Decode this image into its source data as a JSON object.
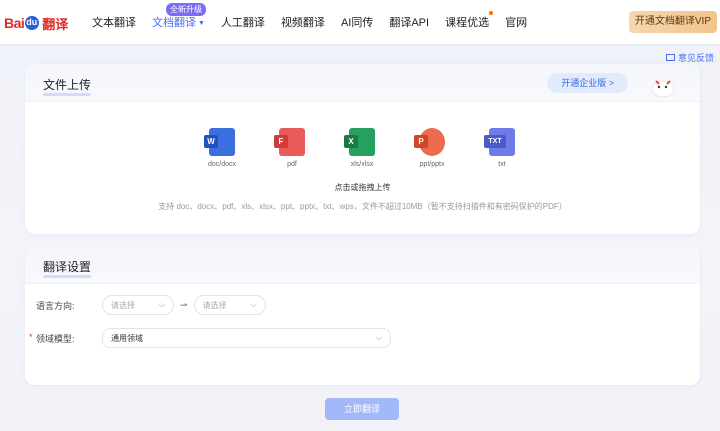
{
  "header": {
    "logo": {
      "bai": "Bai",
      "du": "du",
      "fanyi": "翻译"
    },
    "nav": [
      {
        "label": "文本翻译"
      },
      {
        "label": "文档翻译",
        "badge": "全新升级",
        "active": true
      },
      {
        "label": "人工翻译"
      },
      {
        "label": "视频翻译"
      },
      {
        "label": "AI同传"
      },
      {
        "label": "翻译API"
      },
      {
        "label": "课程优选"
      },
      {
        "label": "官网"
      }
    ],
    "vip_label": "开通文档翻译VIP"
  },
  "feedback_label": "意见反馈",
  "upload": {
    "title": "文件上传",
    "enterprise_label": "开通企业版 >",
    "file_types": [
      {
        "label": "doc/docx",
        "tag": "W",
        "color": "#2b5bd6"
      },
      {
        "label": "pdf",
        "tag": "F",
        "color": "#e24a4a"
      },
      {
        "label": "xls/xlsx",
        "tag": "X",
        "color": "#1f8c52"
      },
      {
        "label": "ppt/pptx",
        "tag": "P",
        "color": "#e2533a"
      },
      {
        "label": "txt",
        "tag": "TXT",
        "color": "#5b6bd8"
      }
    ],
    "hint": "点击或拖拽上传",
    "support": "支持 doc、docx、pdf、xls、xlsx、ppt、pptx、txt、wps，文件不超过10MB（暂不支持扫描件和有密码保护的PDF）"
  },
  "settings": {
    "title": "翻译设置",
    "direction_label": "语言方向:",
    "source_placeholder": "请选择",
    "target_placeholder": "请选择",
    "domain_label": "领域模型:",
    "domain_value": "通用领域",
    "required_mark": "*"
  },
  "translate_label": "立即翻译"
}
